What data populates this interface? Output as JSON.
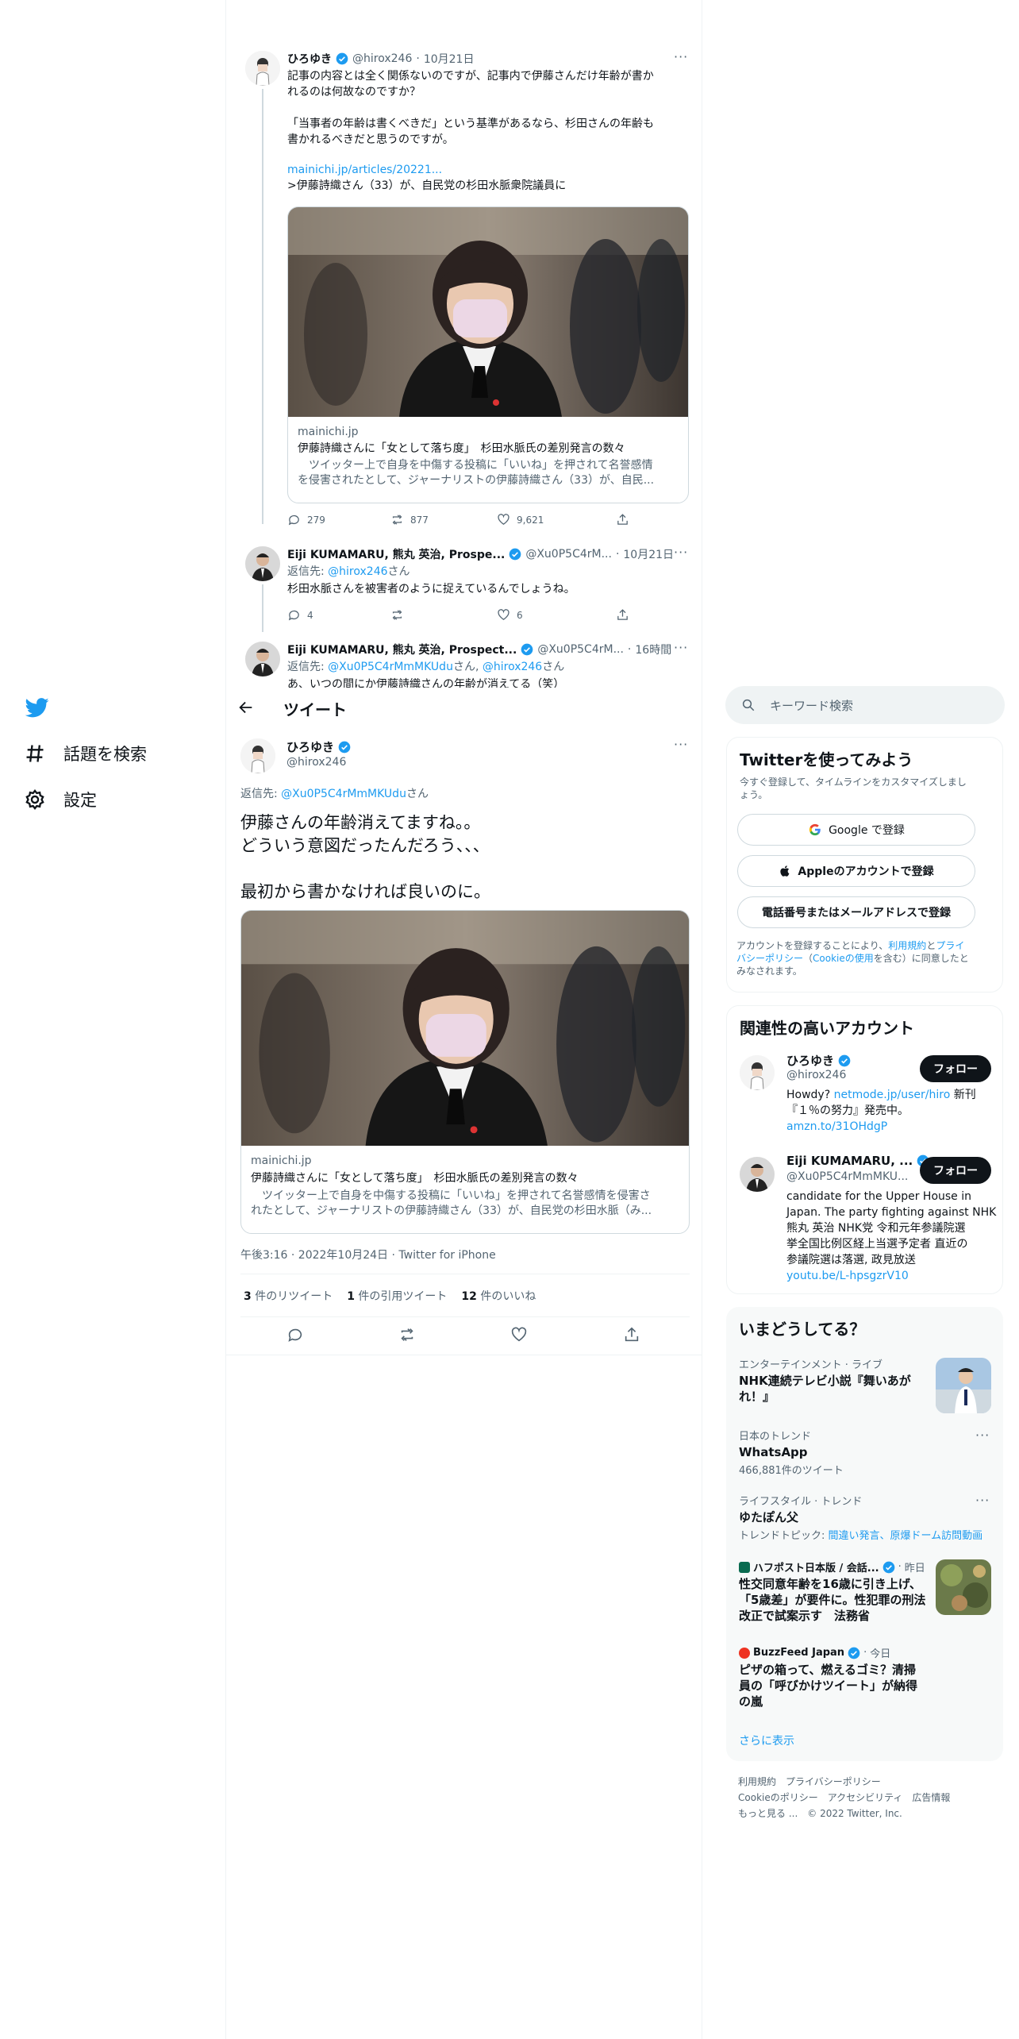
{
  "nav": {
    "explore_label": "話題を検索",
    "settings_label": "設定"
  },
  "thread": [
    {
      "name": "ひろゆき",
      "handle": "@hirox246",
      "date": "10月21日",
      "text_lines": [
        "記事の内容とは全く関係ないのですが、記事内で伊藤さんだけ年齢が書か",
        "れるのは何故なのですか？",
        "",
        "「当事者の年齢は書くべきだ」という基準があるなら、杉田さんの年齢も",
        "書かれるべきだと思うのですが。"
      ],
      "link": "mainichi.jp/articles/20221...",
      "quote": ">伊藤詩織さん（33）が、自民党の杉田水脈衆院議員に",
      "card": {
        "domain": "mainichi.jp",
        "title": "伊藤詩織さんに「女として落ち度」　杉田水脈氏の差別発言の数々",
        "desc_lines": [
          "　ツイッター上で自身を中傷する投稿に「いいね」を押されて名誉感情",
          "を侵害されたとして、ジャーナリストの伊藤詩織さん（33）が、自民..."
        ]
      },
      "replies": "279",
      "retweets": "877",
      "likes": "9,621"
    },
    {
      "name": "Eiji KUMAMARU, 熊丸 英治, Prospe...",
      "handle": "@Xu0P5C4rM...",
      "date": "10月21日",
      "reply_to_prefix": "返信先: ",
      "reply_to": "@hirox246",
      "reply_to_suffix": "さん",
      "text": "杉田水脈さんを被害者のように捉えているんでしょうね。",
      "replies": "4",
      "retweets": "",
      "likes": "6"
    },
    {
      "name": "Eiji KUMAMARU, 熊丸 英治, Prospect...",
      "handle": "@Xu0P5C4rM...",
      "date": "16時間",
      "reply_to_prefix": "返信先: ",
      "reply_to": "@Xu0P5C4rMmMKUdu",
      "reply_to_mid": "さん, ",
      "reply_to_2": "@hirox246",
      "reply_to_suffix": "さん",
      "text": "あ、いつの間にか伊藤詩織さんの年齢が消えてる（笑）"
    }
  ],
  "header": {
    "title": "ツイート"
  },
  "main_tweet": {
    "name": "ひろゆき",
    "handle": "@hirox246",
    "reply_to_prefix": "返信先: ",
    "reply_to": "@Xu0P5C4rMmMKUdu",
    "reply_to_suffix": "さん",
    "text_lines": [
      "伊藤さんの年齢消えてますね。。",
      "どういう意図だったんだろう、、、",
      "",
      "最初から書かなければ良いのに。"
    ],
    "card": {
      "domain": "mainichi.jp",
      "title": "伊藤詩織さんに「女として落ち度」　杉田水脈氏の差別発言の数々",
      "desc_lines": [
        "　ツイッター上で自身を中傷する投稿に「いいね」を押されて名誉感情を侵害さ",
        "れたとして、ジャーナリストの伊藤詩織さん（33）が、自民党の杉田水脈（み..."
      ]
    },
    "timestamp": "午後3:16 · 2022年10月24日 · Twitter for iPhone",
    "retweet_count": "3",
    "retweet_label": "件のリツイート",
    "quote_count": "1",
    "quote_label": "件の引用ツイート",
    "like_count": "12",
    "like_label": "件のいいね"
  },
  "search": {
    "placeholder": "キーワード検索"
  },
  "signup": {
    "title": "Twitterを使ってみよう",
    "subtitle_lines": [
      "今すぐ登録して、タイムラインをカスタマイズしまし",
      "ょう。"
    ],
    "google_label": "Google で登録",
    "apple_label": "Appleのアカウントで登録",
    "phone_label": "電話番号またはメールアドレスで登録",
    "legal_1": "アカウントを登録することにより、",
    "legal_terms": "利用規約",
    "legal_and": "と",
    "legal_privacy_a": "プライ",
    "legal_privacy_b": "バシーポリシー",
    "legal_paren_open": "（",
    "legal_cookie": "Cookieの使用",
    "legal_2": "を含む）に同意したと",
    "legal_3": "みなされます。"
  },
  "relevant": {
    "title": "関連性の高いアカウント",
    "follow_label": "フォロー",
    "accounts": [
      {
        "name": "ひろゆき",
        "handle": "@hirox246",
        "bio_1a": "Howdy? ",
        "bio_1b": "netmode.jp/user/hiro",
        "bio_1c": " 新刊",
        "bio_2": "『１％の努力』発売中。",
        "bio_3": "amzn.to/31OHdgP"
      },
      {
        "name": "Eiji KUMAMARU, ...",
        "handle": "@Xu0P5C4rMmMKU...",
        "bio_lines": [
          "candidate for the Upper House in",
          "Japan. The party fighting against NHK",
          "熊丸 英治 NHK党 令和元年参議院選",
          "挙全国比例区経上当選予定者 直近の",
          "参議院選は落選, 政見放送"
        ],
        "bio_link": "youtu.be/L-hpsgzrV10"
      }
    ]
  },
  "trends": {
    "title": "いまどうしてる？",
    "items": [
      {
        "meta": "エンターテインメント · ライブ",
        "title_lines": [
          "NHK連続テレビ小説『舞いあが",
          "れ！』"
        ]
      },
      {
        "meta": "日本のトレンド",
        "title_lines": [
          "WhatsApp"
        ],
        "count": "466,881件のツイート"
      },
      {
        "meta": "ライフスタイル · トレンド",
        "title_lines": [
          "ゆたぽん父"
        ],
        "topic_prefix": "トレンドトピック: ",
        "topic": "間違い発言、原爆ドーム訪問動画"
      },
      {
        "source": "ハフポスト日本版 / 会話...",
        "when": "昨日",
        "title_lines": [
          "性交同意年齢を16歳に引き上げ、",
          "「5歳差」が要件に。性犯罪の刑法",
          "改正で試案示す　法務省"
        ]
      },
      {
        "source": "BuzzFeed Japan",
        "when": "今日",
        "title_lines": [
          "ピザの箱って、燃えるゴミ？清掃",
          "員の「呼びかけツイート」が納得",
          "の嵐"
        ]
      }
    ],
    "show_more": "さらに表示"
  },
  "footer": {
    "terms": "利用規約",
    "privacy": "プライバシーポリシー",
    "cookie": "Cookieのポリシー",
    "accessibility": "アクセシビリティ",
    "ads": "広告情報",
    "more": "もっと見る ...",
    "copyright": "© 2022 Twitter, Inc."
  },
  "colors": {
    "accent": "#1d9bf0",
    "text": "#0f1419",
    "muted": "#536471"
  }
}
